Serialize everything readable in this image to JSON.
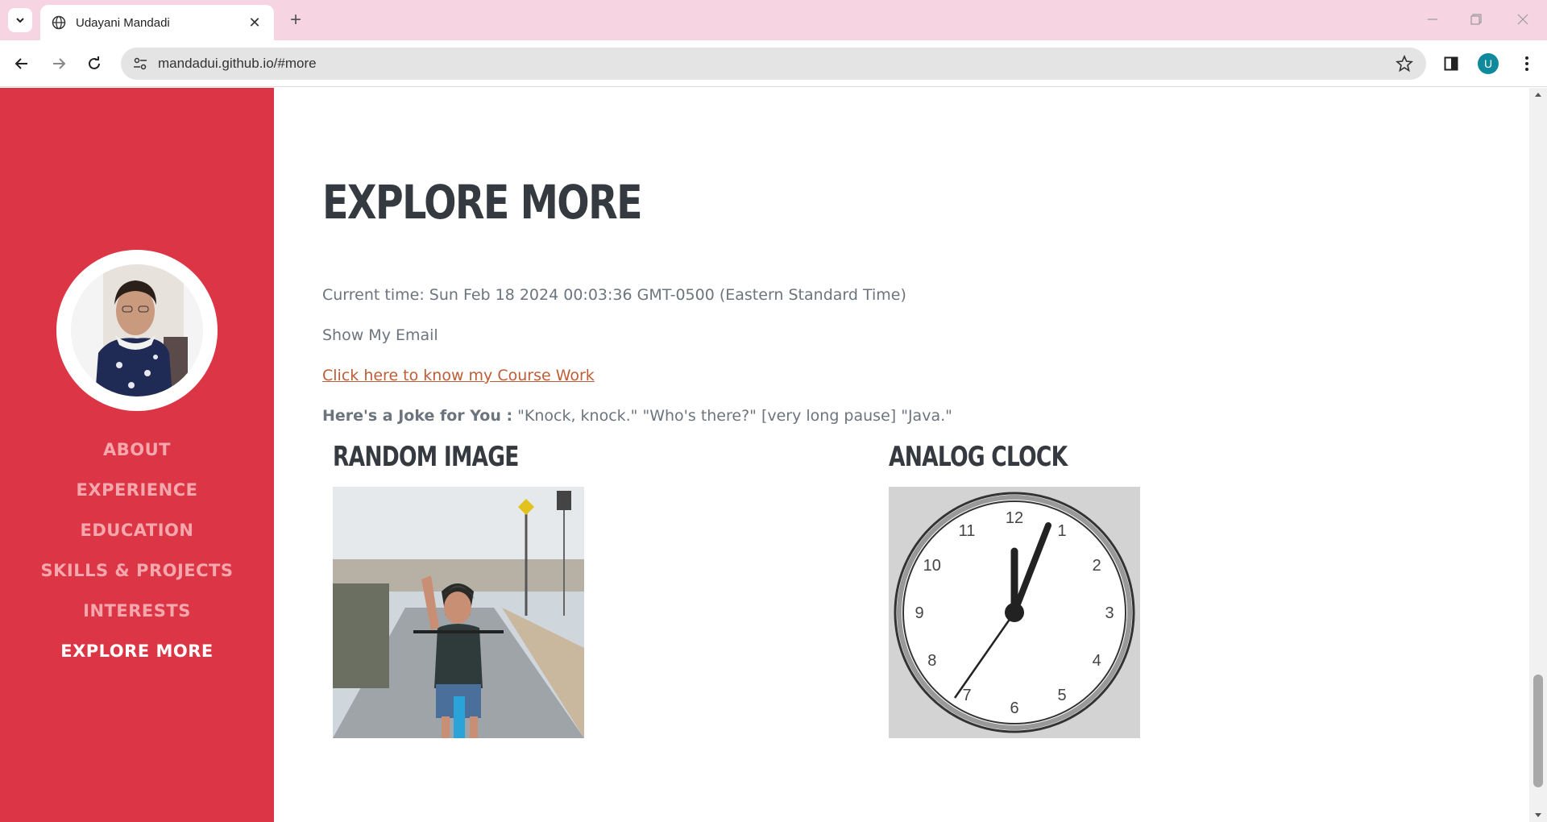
{
  "browser": {
    "tab_title": "Udayani Mandadi",
    "url": "mandadui.github.io/#more",
    "profile_initial": "U"
  },
  "sidebar": {
    "nav": [
      {
        "label": "ABOUT"
      },
      {
        "label": "EXPERIENCE"
      },
      {
        "label": "EDUCATION"
      },
      {
        "label": "SKILLS & PROJECTS"
      },
      {
        "label": "INTERESTS"
      },
      {
        "label": "EXPLORE MORE"
      }
    ],
    "active_index": 5
  },
  "main": {
    "heading": "EXPLORE MORE",
    "current_time": "Current time: Sun Feb 18 2024 00:03:36 GMT-0500 (Eastern Standard Time)",
    "show_email": "Show My Email",
    "course_link": "Click here to know my Course Work",
    "joke_label": "Here's a Joke for You :",
    "joke_text": " \"Knock, knock.\" \"Who's there?\" [very long pause] \"Java.\"",
    "random_image_heading": "RANDOM IMAGE",
    "analog_clock_heading": "ANALOG CLOCK",
    "clock_numbers": [
      "12",
      "1",
      "2",
      "3",
      "4",
      "5",
      "6",
      "7",
      "8",
      "9",
      "10",
      "11"
    ]
  },
  "colors": {
    "sidebar": "#dc3545",
    "link": "#bd5d38",
    "tabbar": "#f6d4e2"
  }
}
